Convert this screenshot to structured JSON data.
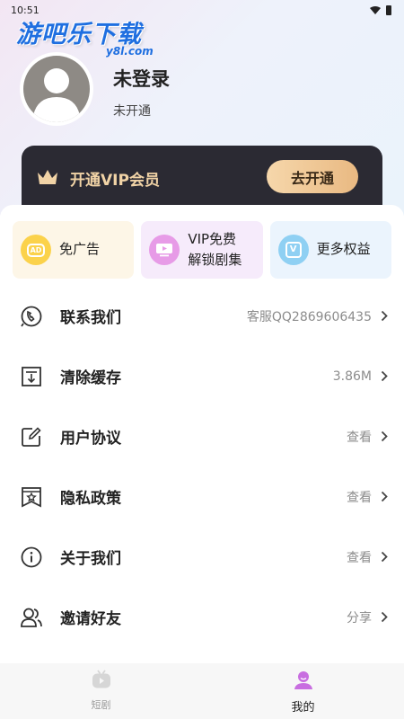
{
  "status_bar": {
    "time": "10:51"
  },
  "watermark": {
    "title": "游吧乐下载",
    "subtitle": "y8l.com"
  },
  "profile": {
    "username": "未登录",
    "membership_status": "未开通"
  },
  "vip_banner": {
    "label": "开通VIP会员",
    "button_label": "去开通"
  },
  "features": [
    {
      "label": "免广告",
      "icon": "ad-icon"
    },
    {
      "label_line1": "VIP免费",
      "label_line2": "解锁剧集",
      "icon": "tv-icon"
    },
    {
      "label": "更多权益",
      "icon": "v-badge-icon"
    }
  ],
  "features_ad_text": "AD",
  "features_more_text": "V",
  "menu": [
    {
      "label": "联系我们",
      "value": "客服QQ2869606435",
      "icon": "phone-support-icon"
    },
    {
      "label": "清除缓存",
      "value": "3.86M",
      "icon": "clear-cache-icon"
    },
    {
      "label": "用户协议",
      "value": "查看",
      "icon": "edit-document-icon"
    },
    {
      "label": "隐私政策",
      "value": "查看",
      "icon": "privacy-star-icon"
    },
    {
      "label": "关于我们",
      "value": "查看",
      "icon": "info-icon"
    },
    {
      "label": "邀请好友",
      "value": "分享",
      "icon": "invite-friends-icon"
    }
  ],
  "tabbar": [
    {
      "label": "短剧",
      "active": false,
      "icon": "tv-tab-icon"
    },
    {
      "label": "我的",
      "active": true,
      "icon": "profile-tab-icon"
    }
  ],
  "colors": {
    "vip_gold": "#f1d3a6",
    "vip_card_bg": "#2b2a33",
    "active_tab_icon": "#c86ee0",
    "watermark_blue": "#1f6fe0"
  }
}
